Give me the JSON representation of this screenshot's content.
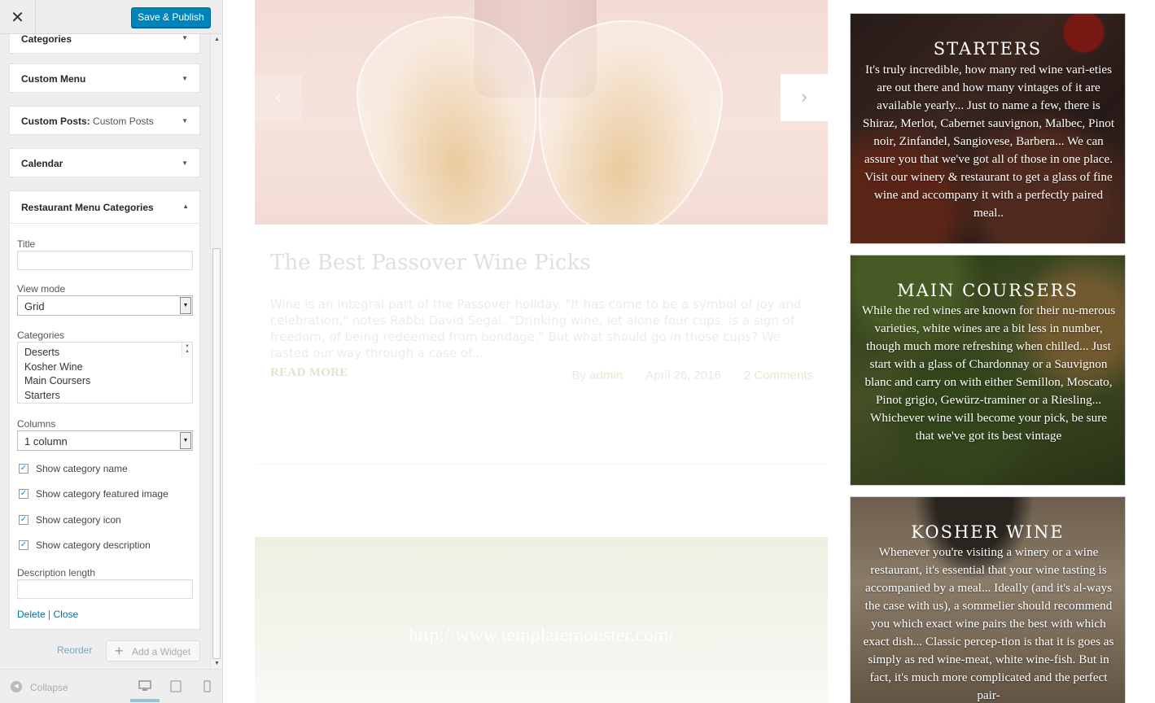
{
  "customizer": {
    "close_icon": "close-icon",
    "publish_label": "Save & Publish",
    "sections": [
      {
        "title": "Categories",
        "subtitle": ""
      },
      {
        "title": "Custom Menu",
        "subtitle": ""
      },
      {
        "title": "Custom Posts:",
        "subtitle": "Custom Posts"
      },
      {
        "title": "Calendar",
        "subtitle": ""
      }
    ],
    "widget": {
      "title": "Restaurant Menu Categories",
      "title_label": "Title",
      "title_value": "",
      "view_mode_label": "View mode",
      "view_mode_value": "Grid",
      "categories_label": "Categories",
      "categories": [
        "Deserts",
        "Kosher Wine",
        "Main Coursers",
        "Starters"
      ],
      "columns_label": "Columns",
      "columns_value": "1 column",
      "checkboxes": [
        {
          "label": "Show category name",
          "checked": true
        },
        {
          "label": "Show category featured image",
          "checked": true
        },
        {
          "label": "Show category icon",
          "checked": true
        },
        {
          "label": "Show category description",
          "checked": true
        }
      ],
      "description_length_label": "Description length",
      "description_length_value": "",
      "delete_label": "Delete",
      "link_separator": "|",
      "close_label": "Close"
    },
    "reorder_label": "Reorder",
    "add_widget_label": "Add a Widget",
    "collapse_label": "Collapse"
  },
  "preview": {
    "post": {
      "title": "The Best Passover Wine Picks",
      "excerpt": "Wine is an integral part of the Passover holiday. \"It has come to be a symbol of joy and celebration,\" notes Rabbi David Segal. \"Drinking wine, let alone four cups, is a sign of freedom, of being redeemed from bondage.\" But what should go in those cups? We tasted our way through a case of...",
      "read_more": "READ MORE",
      "by": "By",
      "author": "admin",
      "date": "April 26, 2016",
      "comments": "2 Comments"
    },
    "watermark_url": "http://www.templatemonster.com/",
    "cards": [
      {
        "title": "STARTERS",
        "text": "It's truly incredible, how many red wine vari-eties are out there and how many vintages of it are available yearly... Just to name a few, there is Shiraz, Merlot, Cabernet sauvignon, Malbec, Pinot noir, Zinfandel, Sangiovese, Barbera... We can assure you that we've got all of those in one place. Visit our winery & restaurant to get a glass of fine wine and accompany it with a perfectly paired meal.."
      },
      {
        "title": "MAIN COURSERS",
        "text": "While the red wines are known for their nu-merous varieties, white wines are a bit less in number, though much more refreshing when chilled... Just start with a glass of Chardonnay or a Sauvignon blanc and carry on with either Semillon, Moscato, Pinot grigio, Gewürz-traminer or a Riesling... Whichever wine will become your pick, be sure that we've got its best vintage"
      },
      {
        "title": "KOSHER WINE",
        "text": "Whenever you're visiting a winery or a wine restaurant, it's essential that your wine tasting is accompanied by a meal... Ideally (and it's al-ways the case with us), a sommelier should recommend you which exact wine pairs the best with which exact dish... Classic percep-tion is that it is goes as simply as red wine-meat, white wine-fish. But in fact, it's much more complicated and the perfect pair-"
      }
    ]
  }
}
